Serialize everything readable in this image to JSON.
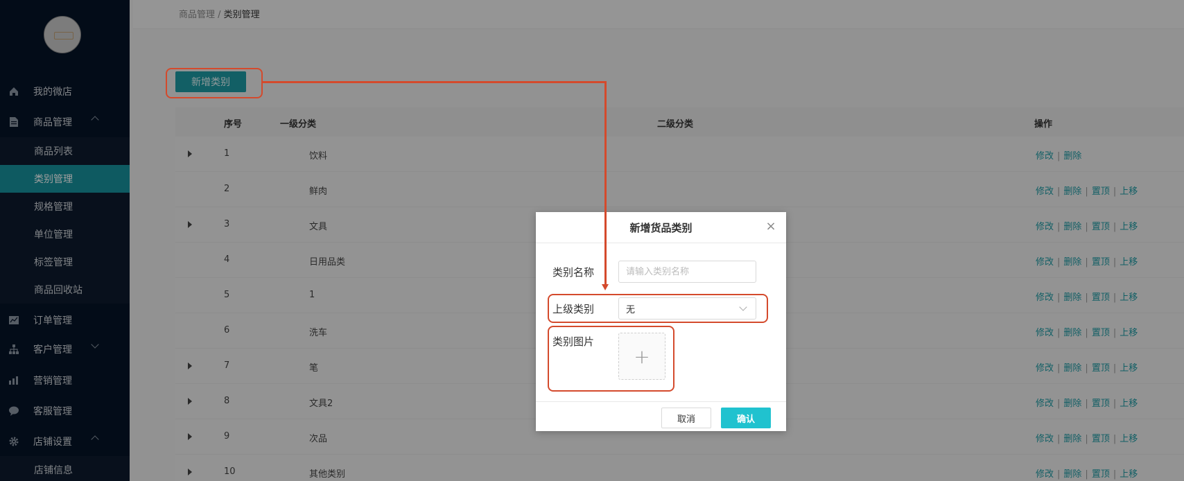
{
  "sidebar": {
    "items": [
      {
        "label": "我的微店",
        "icon": "home-icon"
      },
      {
        "label": "商品管理",
        "icon": "document-icon"
      },
      {
        "label": "订单管理",
        "icon": "chart-icon"
      },
      {
        "label": "客户管理",
        "icon": "org-icon"
      },
      {
        "label": "营销管理",
        "icon": "bars-icon"
      },
      {
        "label": "客服管理",
        "icon": "chat-icon"
      },
      {
        "label": "店铺设置",
        "icon": "gear-icon"
      }
    ],
    "product_sub": [
      "商品列表",
      "类别管理",
      "规格管理",
      "单位管理",
      "标签管理",
      "商品回收站"
    ],
    "shop_sub": [
      "店铺信息"
    ]
  },
  "breadcrumb": {
    "parent": "商品管理",
    "sep": " / ",
    "current": "类别管理"
  },
  "toolbar": {
    "add_label": "新增类别"
  },
  "table": {
    "headers": {
      "index": "序号",
      "level1": "一级分类",
      "level2": "二级分类",
      "ops": "操作"
    },
    "rows": [
      {
        "num": "1",
        "name": "饮料"
      },
      {
        "num": "2",
        "name": "鲜肉"
      },
      {
        "num": "3",
        "name": "文具"
      },
      {
        "num": "4",
        "name": "日用品类"
      },
      {
        "num": "5",
        "name": "1"
      },
      {
        "num": "6",
        "name": "洗车"
      },
      {
        "num": "7",
        "name": "笔"
      },
      {
        "num": "8",
        "name": "文具2"
      },
      {
        "num": "9",
        "name": "次品"
      },
      {
        "num": "10",
        "name": "其他类别"
      }
    ],
    "ops": {
      "edit": "修改",
      "delete": "删除",
      "top": "置顶",
      "up": "上移",
      "sep": "|"
    }
  },
  "modal": {
    "title": "新增货品类别",
    "close": "×",
    "name_label": "类别名称",
    "name_placeholder": "请输入类别名称",
    "parent_label": "上级类别",
    "parent_value": "无",
    "image_label": "类别图片",
    "upload_plus": "+",
    "cancel_label": "取消",
    "ok_label": "确认"
  },
  "colors": {
    "accent": "#1e9aa4",
    "annotation": "#d44a2c",
    "sidebar": "#061428"
  }
}
